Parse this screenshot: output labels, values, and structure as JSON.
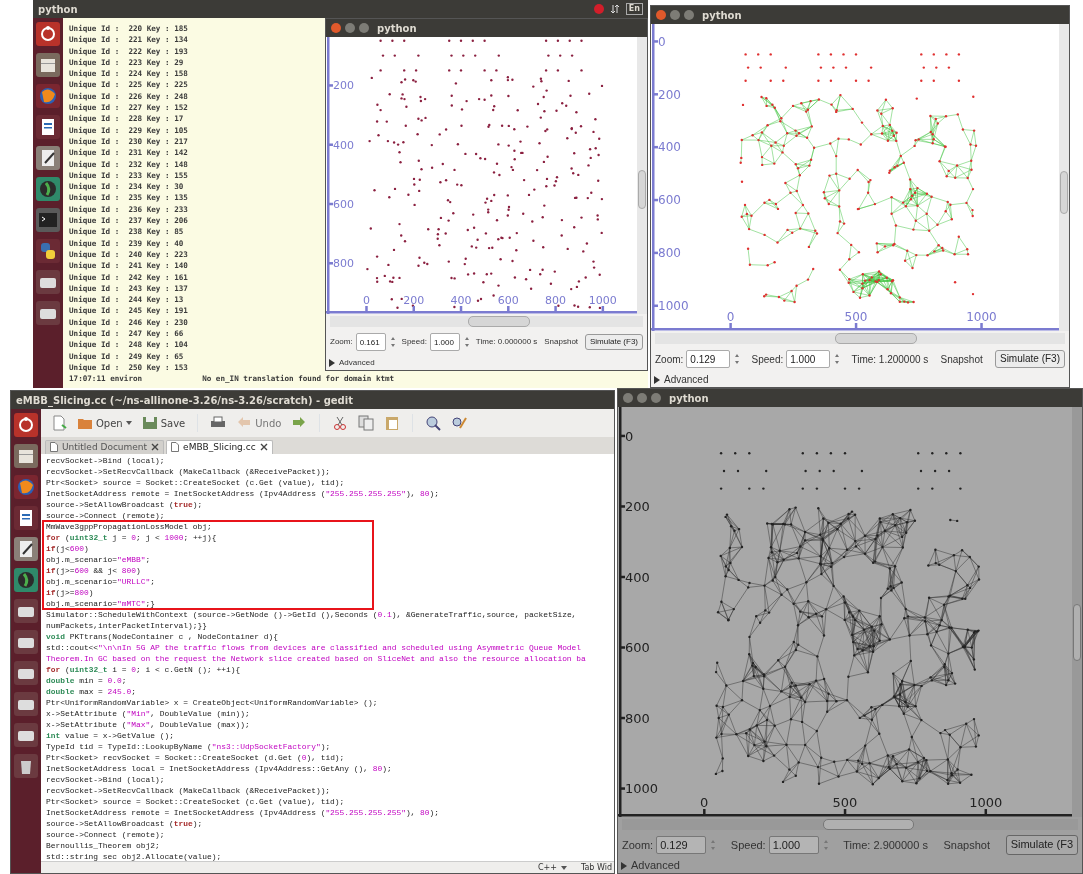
{
  "top_panel": {
    "title": "python",
    "keyboard": "En"
  },
  "terminal": {
    "launcher": [
      {
        "kind": "ubuntu"
      },
      {
        "kind": "files"
      },
      {
        "kind": "browser"
      },
      {
        "kind": "writer"
      },
      {
        "kind": "editor"
      },
      {
        "kind": "globe"
      },
      {
        "kind": "terminal"
      },
      {
        "kind": "python"
      },
      {
        "kind": "drive"
      },
      {
        "kind": "drive"
      }
    ],
    "lines": [
      "Unique Id :  220 Key : 185",
      "Unique Id :  221 Key : 134",
      "Unique Id :  222 Key : 193",
      "Unique Id :  223 Key : 29",
      "Unique Id :  224 Key : 158",
      "Unique Id :  225 Key : 225",
      "Unique Id :  226 Key : 248",
      "Unique Id :  227 Key : 152",
      "Unique Id :  228 Key : 17",
      "Unique Id :  229 Key : 105",
      "Unique Id :  230 Key : 217",
      "Unique Id :  231 Key : 142",
      "Unique Id :  232 Key : 148",
      "Unique Id :  233 Key : 155",
      "Unique Id :  234 Key : 30",
      "Unique Id :  235 Key : 135",
      "Unique Id :  236 Key : 233",
      "Unique Id :  237 Key : 206",
      "Unique Id :  238 Key : 85",
      "Unique Id :  239 Key : 40",
      "Unique Id :  240 Key : 223",
      "Unique Id :  241 Key : 140",
      "Unique Id :  242 Key : 161",
      "Unique Id :  243 Key : 137",
      "Unique Id :  244 Key : 13",
      "Unique Id :  245 Key : 191",
      "Unique Id :  246 Key : 230",
      "Unique Id :  247 Key : 66",
      "Unique Id :  248 Key : 104",
      "Unique Id :  249 Key : 65",
      "Unique Id :  250 Key : 153"
    ],
    "status": [
      "17:07:11 environ",
      "No en_IN translation found for domain ktmt"
    ]
  },
  "sim_windows": [
    {
      "kind": "dots",
      "title": "python",
      "y_ticks": [
        "200",
        "400",
        "600",
        "800"
      ],
      "x_ticks": [
        "0",
        "200",
        "400",
        "600",
        "800",
        "1000"
      ],
      "zoom_label": "Zoom:",
      "zoom": "0.161",
      "speed_label": "Speed:",
      "speed": "1.000",
      "time": "Time: 0.000000 s",
      "snapshot": "Snapshot",
      "simulate": "Simulate (F3)",
      "advanced": "Advanced"
    },
    {
      "kind": "green-links",
      "title": "python",
      "y_ticks": [
        "0",
        "200",
        "400",
        "600",
        "800",
        "1000"
      ],
      "x_ticks": [
        "0",
        "500",
        "1000"
      ],
      "zoom_label": "Zoom:",
      "zoom": "0.129",
      "speed_label": "Speed:",
      "speed": "1.000",
      "time": "Time: 1.200000 s",
      "snapshot": "Snapshot",
      "simulate": "Simulate (F3)",
      "advanced": "Advanced"
    },
    {
      "kind": "gray-links",
      "title": "python",
      "y_ticks": [
        "0",
        "200",
        "400",
        "600",
        "800",
        "1000"
      ],
      "x_ticks": [
        "0",
        "500",
        "1000"
      ],
      "zoom_label": "Zoom:",
      "zoom": "0.129",
      "speed_label": "Speed:",
      "speed": "1.000",
      "time": "Time: 2.900000 s",
      "snapshot": "Snapshot",
      "simulate": "Simulate (F3",
      "advanced": "Advanced"
    }
  ],
  "gedit": {
    "title": "eMBB_Slicing.cc (~/ns-allinone-3.26/ns-3.26/scratch) - gedit",
    "launcher": [
      {
        "kind": "ubuntu"
      },
      {
        "kind": "files"
      },
      {
        "kind": "browser"
      },
      {
        "kind": "writer"
      },
      {
        "kind": "editor"
      },
      {
        "kind": "globe"
      },
      {
        "kind": "drive"
      },
      {
        "kind": "drive"
      },
      {
        "kind": "drive"
      },
      {
        "kind": "drive"
      },
      {
        "kind": "drive"
      },
      {
        "kind": "trash"
      }
    ],
    "toolbar": [
      {
        "kind": "new",
        "disabled": false
      },
      {
        "kind": "open",
        "label": "Open",
        "disabled": false
      },
      {
        "kind": "save",
        "label": "Save",
        "disabled": false
      },
      {
        "kind": "print",
        "disabled": false
      },
      {
        "kind": "undo",
        "label": "Undo",
        "disabled": true
      },
      {
        "kind": "redo",
        "disabled": false
      },
      {
        "kind": "cut",
        "disabled": false
      },
      {
        "kind": "copy",
        "disabled": false
      },
      {
        "kind": "paste",
        "disabled": false
      },
      {
        "kind": "find",
        "disabled": false
      },
      {
        "kind": "replace",
        "disabled": false
      }
    ],
    "tabs": [
      {
        "label": "Untitled Document",
        "selected": false
      },
      {
        "label": "eMBB_Slicing.cc",
        "selected": true
      }
    ],
    "code": [
      [
        "recvSocket->Bind (local);"
      ],
      [
        "recvSocket->SetRecvCallback (MakeCallback (&ReceivePacket));"
      ],
      [
        "Ptr<Socket> source = Socket::CreateSocket (c.Get (value), tid);"
      ],
      [
        "InetSocketAddress remote = InetSocketAddress (Ipv4Address (",
        {
          "text": "\"255.255.255.255\"",
          "kind": "str"
        },
        "), ",
        {
          "text": "80",
          "kind": "str"
        },
        ");"
      ],
      [
        "source->SetAllowBroadcast (",
        {
          "text": "true",
          "kind": "kw"
        },
        ");"
      ],
      [
        "source->Connect (remote);"
      ],
      [
        "MmWave3gppPropagationLossModel obj;"
      ],
      [
        {
          "text": "for",
          "kind": "kw"
        },
        " (",
        {
          "text": "uint32_t",
          "kind": "type"
        },
        " j = ",
        {
          "text": "0",
          "kind": "str"
        },
        "; j < ",
        {
          "text": "1000",
          "kind": "str"
        },
        "; ++j){"
      ],
      [
        {
          "text": "if",
          "kind": "kw"
        },
        "(j<",
        {
          "text": "600",
          "kind": "str"
        },
        ")"
      ],
      [
        "obj.m_scenario=",
        {
          "text": "\"eMBB\"",
          "kind": "str"
        },
        ";"
      ],
      [
        {
          "text": "if",
          "kind": "kw"
        },
        "(j>=",
        {
          "text": "600",
          "kind": "str"
        },
        " && j< ",
        {
          "text": "800",
          "kind": "str"
        },
        ")"
      ],
      [
        "obj.m_scenario=",
        {
          "text": "\"URLLC\"",
          "kind": "str"
        },
        ";"
      ],
      [
        {
          "text": "if",
          "kind": "kw"
        },
        "(j>=",
        {
          "text": "800",
          "kind": "str"
        },
        ")"
      ],
      [
        "obj.m_scenario=",
        {
          "text": "\"mMTC\"",
          "kind": "str"
        },
        ";}"
      ],
      [
        "Simulator::ScheduleWithContext (source->GetNode ()->GetId (),Seconds (",
        {
          "text": "0.1",
          "kind": "str"
        },
        "), &GenerateTraffic,source, packetSize,"
      ],
      [
        "numPackets,interPacketInterval);}}"
      ],
      [
        {
          "text": "void",
          "kind": "type"
        },
        " PKTtrans(NodeContainer c , NodeContainer d){"
      ],
      [
        "std::cout<<",
        {
          "text": "\"\\n\\nIn 5G AP the traffic flows from devices are classified and scheduled using Asymmetric Queue Model",
          "kind": "str"
        }
      ],
      [
        {
          "text": "Theorem.In GC based on the request the Network slice created based on SliceNet and also the resource allocation ba",
          "kind": "str"
        }
      ],
      [
        {
          "text": "for",
          "kind": "kw"
        },
        " (",
        {
          "text": "uint32_t",
          "kind": "type"
        },
        " i = ",
        {
          "text": "0",
          "kind": "str"
        },
        "; i < c.GetN (); ++i){"
      ],
      [
        {
          "text": "double",
          "kind": "type"
        },
        " min = ",
        {
          "text": "0.0",
          "kind": "str"
        },
        ";"
      ],
      [
        {
          "text": "double",
          "kind": "type"
        },
        " max = ",
        {
          "text": "245.0",
          "kind": "str"
        },
        ";"
      ],
      [
        "Ptr<UniformRandomVariable> x = CreateObject<UniformRandomVariable> ();"
      ],
      [
        "x->SetAttribute (",
        {
          "text": "\"Min\"",
          "kind": "str"
        },
        ", DoubleValue (min));"
      ],
      [
        "x->SetAttribute (",
        {
          "text": "\"Max\"",
          "kind": "str"
        },
        ", DoubleValue (max));"
      ],
      [
        {
          "text": "int",
          "kind": "type"
        },
        " value = x->GetValue ();"
      ],
      [
        "TypeId tid = TypeId::LookupByName (",
        {
          "text": "\"ns3::UdpSocketFactory\"",
          "kind": "str"
        },
        ");"
      ],
      [
        "Ptr<Socket> recvSocket = Socket::CreateSocket (d.Get (",
        {
          "text": "0",
          "kind": "str"
        },
        "), tid);"
      ],
      [
        "InetSocketAddress local = InetSocketAddress (Ipv4Address::GetAny (), ",
        {
          "text": "80",
          "kind": "str"
        },
        ");"
      ],
      [
        "recvSocket->Bind (local);"
      ],
      [
        "recvSocket->SetRecvCallback (MakeCallback (&ReceivePacket));"
      ],
      [
        "Ptr<Socket> source = Socket::CreateSocket (c.Get (value), tid);"
      ],
      [
        "InetSocketAddress remote = InetSocketAddress (Ipv4Address (",
        {
          "text": "\"255.255.255.255\"",
          "kind": "str"
        },
        "), ",
        {
          "text": "80",
          "kind": "str"
        },
        ");"
      ],
      [
        "source->SetAllowBroadcast (",
        {
          "text": "true",
          "kind": "kw"
        },
        ");"
      ],
      [
        "source->Connect (remote);"
      ],
      [
        "Bernoullis_Theorem obj2;"
      ],
      [
        "std::string sec obj2.Allocate(value);"
      ]
    ],
    "status": {
      "language": "C++",
      "tab_width": "Tab Wid"
    }
  }
}
